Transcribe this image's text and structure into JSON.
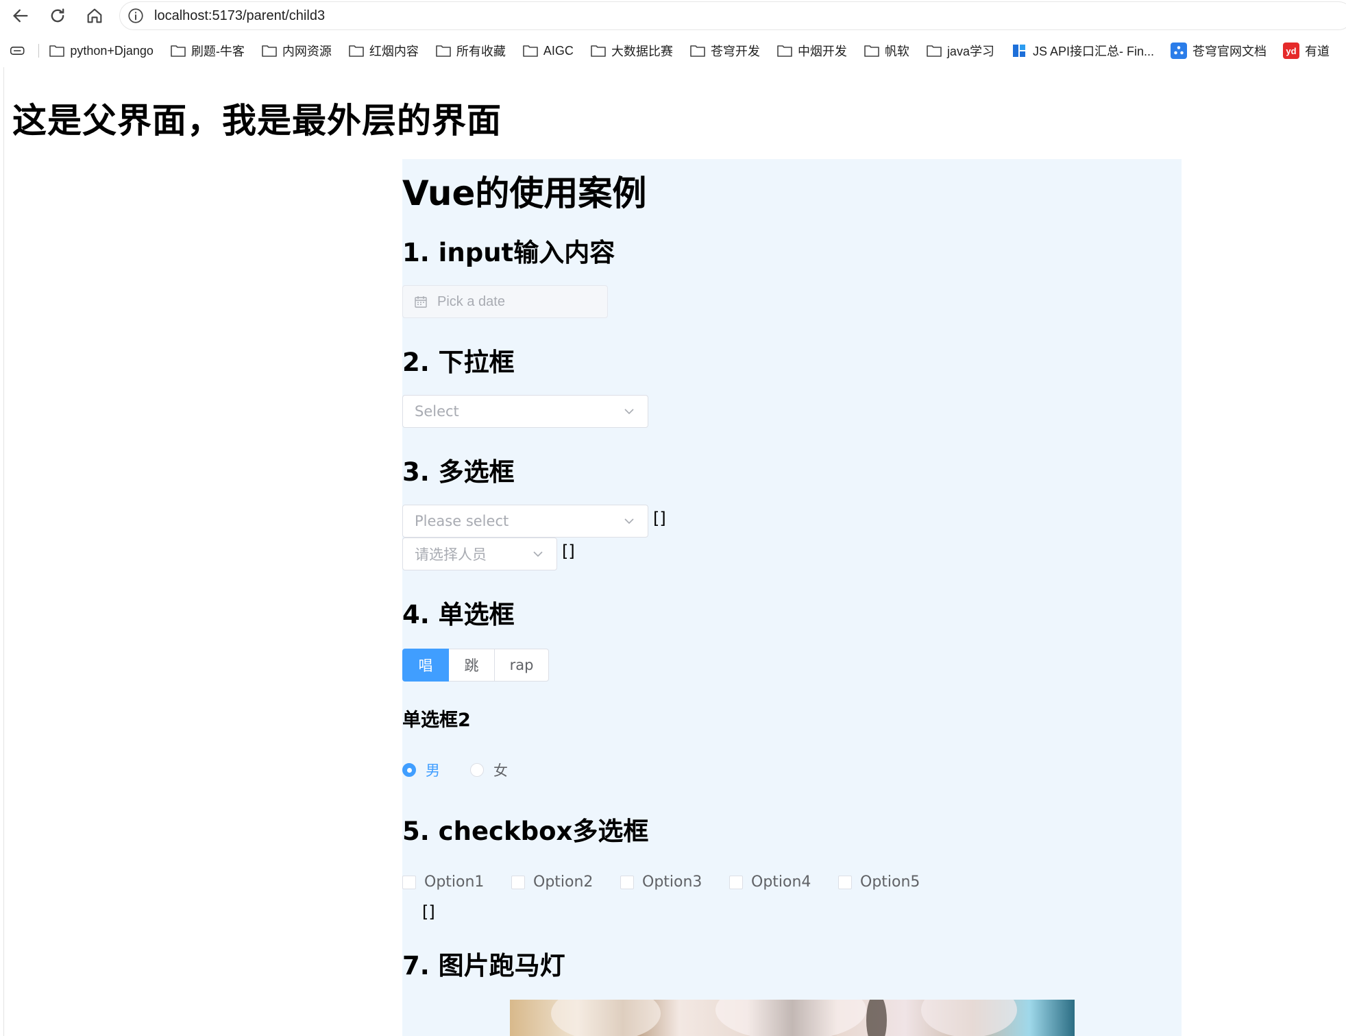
{
  "browser": {
    "url": "localhost:5173/parent/child3",
    "bookmarks": [
      {
        "label": "python+Django",
        "icon": "folder-icon"
      },
      {
        "label": "刷题-牛客",
        "icon": "folder-icon"
      },
      {
        "label": "内网资源",
        "icon": "folder-icon"
      },
      {
        "label": "红烟内容",
        "icon": "folder-icon"
      },
      {
        "label": "所有收藏",
        "icon": "folder-icon"
      },
      {
        "label": "AIGC",
        "icon": "folder-icon"
      },
      {
        "label": "大数据比赛",
        "icon": "folder-icon"
      },
      {
        "label": "苍穹开发",
        "icon": "folder-icon"
      },
      {
        "label": "中烟开发",
        "icon": "folder-icon"
      },
      {
        "label": "帆软",
        "icon": "folder-icon"
      },
      {
        "label": "java学习",
        "icon": "folder-icon"
      },
      {
        "label": "JS API接口汇总- Fin...",
        "icon": "finereport-favicon"
      },
      {
        "label": "苍穹官网文档",
        "icon": "kingdee-favicon"
      },
      {
        "label": "有道",
        "icon": "youdao-favicon"
      }
    ]
  },
  "page": {
    "title": "这是父界面，我是最外层的界面",
    "panel_title": "Vue的使用案例",
    "sections": {
      "input": "1. input输入内容",
      "select": "2. 下拉框",
      "multi": "3. 多选框",
      "radio": "4. 单选框",
      "radio2": "单选框2",
      "checkbox": "5. checkbox多选框",
      "carousel": "7. 图片跑马灯"
    },
    "date_picker": {
      "placeholder": "Pick a date"
    },
    "select": {
      "placeholder": "Select"
    },
    "multi_select": {
      "placeholder": "Please select",
      "value_text": "[]"
    },
    "person_select": {
      "placeholder": "请选择人员",
      "value_text": "[]"
    },
    "radio_buttons": {
      "options": [
        "唱",
        "跳",
        "rap"
      ],
      "selected": "唱"
    },
    "radio_gender": {
      "options": [
        "男",
        "女"
      ],
      "selected": "男"
    },
    "checkbox": {
      "options": [
        "Option1",
        "Option2",
        "Option3",
        "Option4",
        "Option5"
      ],
      "value_text": "[]"
    }
  },
  "colors": {
    "accent": "#409eff",
    "panel_bg": "#eef6fd",
    "placeholder": "#a8abb2",
    "border": "#dcdfe6"
  }
}
